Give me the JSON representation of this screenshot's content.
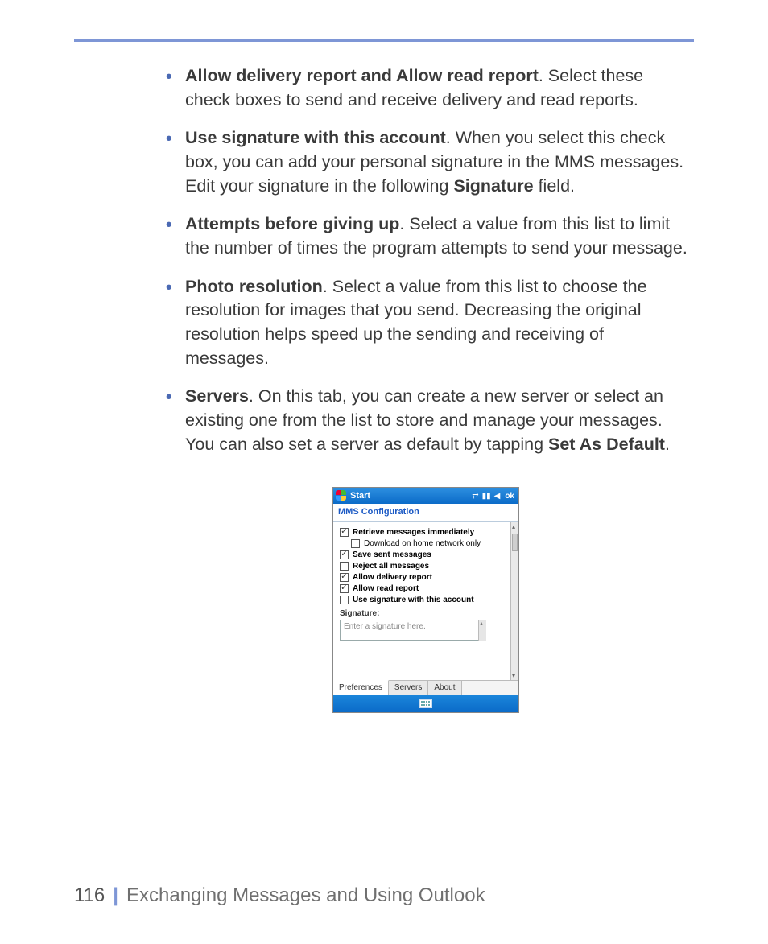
{
  "bullets": [
    {
      "bold": "Allow delivery report and Allow read report",
      "rest": ". Select these check boxes to send and receive delivery and read reports."
    },
    {
      "bold": "Use signature with this account",
      "rest": ". When you select this check box, you can add your personal signature in the MMS messages. Edit your signature in the following ",
      "bold2": "Signature",
      "rest2": " field."
    },
    {
      "bold": "Attempts before giving up",
      "rest": ". Select a value from this list to limit  the number of times the program attempts to send your message."
    },
    {
      "bold": "Photo resolution",
      "rest": ". Select a value from this list to choose the resolution for images that you send. Decreasing the original resolution helps speed up the sending and receiving of messages."
    },
    {
      "bold": "Servers",
      "rest": ". On this tab, you can create a new server or select an existing one from the list to store and manage your messages. You can also set a server as default by tapping ",
      "bold2": "Set As Default",
      "rest2": "."
    }
  ],
  "device": {
    "start": "Start",
    "ok": "ok",
    "status_icons": {
      "connectivity": "⇄",
      "signal": "▮▮",
      "volume": "◀"
    },
    "app_title": "MMS Configuration",
    "checks": [
      {
        "label": "Retrieve messages immediately",
        "checked": true,
        "indent": false
      },
      {
        "label": "Download on home network only",
        "checked": false,
        "indent": true
      },
      {
        "label": "Save sent messages",
        "checked": true,
        "indent": false
      },
      {
        "label": "Reject all messages",
        "checked": false,
        "indent": false
      },
      {
        "label": "Allow delivery report",
        "checked": true,
        "indent": false
      },
      {
        "label": "Allow read report",
        "checked": true,
        "indent": false
      },
      {
        "label": "Use signature with this account",
        "checked": false,
        "indent": false
      }
    ],
    "signature_label": "Signature:",
    "signature_placeholder": "Enter a signature here.",
    "tabs": [
      "Preferences",
      "Servers",
      "About"
    ],
    "active_tab": 0
  },
  "footer": {
    "page": "116",
    "title": "Exchanging Messages and Using Outlook"
  }
}
